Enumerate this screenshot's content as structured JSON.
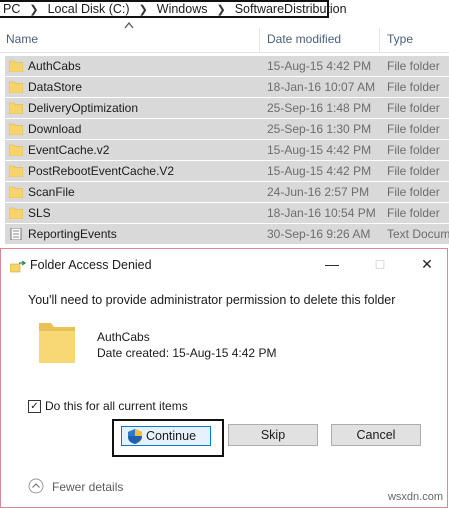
{
  "explorer": {
    "breadcrumb": [
      "PC",
      "Local Disk (C:)",
      "Windows",
      "SoftwareDistribution"
    ],
    "columns": {
      "name": "Name",
      "date": "Date modified",
      "type": "Type"
    },
    "rows": [
      {
        "name": "AuthCabs",
        "date": "15-Aug-15 4:42 PM",
        "type": "File folder",
        "icon": "folder-icon"
      },
      {
        "name": "DataStore",
        "date": "18-Jan-16 10:07 AM",
        "type": "File folder",
        "icon": "folder-icon"
      },
      {
        "name": "DeliveryOptimization",
        "date": "25-Sep-16 1:48 PM",
        "type": "File folder",
        "icon": "folder-icon"
      },
      {
        "name": "Download",
        "date": "25-Sep-16 1:30 PM",
        "type": "File folder",
        "icon": "folder-icon"
      },
      {
        "name": "EventCache.v2",
        "date": "15-Aug-15 4:42 PM",
        "type": "File folder",
        "icon": "folder-icon"
      },
      {
        "name": "PostRebootEventCache.V2",
        "date": "15-Aug-15 4:42 PM",
        "type": "File folder",
        "icon": "folder-icon"
      },
      {
        "name": "ScanFile",
        "date": "24-Jun-16 2:57 PM",
        "type": "File folder",
        "icon": "folder-icon"
      },
      {
        "name": "SLS",
        "date": "18-Jan-16 10:54 PM",
        "type": "File folder",
        "icon": "folder-icon"
      },
      {
        "name": "ReportingEvents",
        "date": "30-Sep-16 9:26 AM",
        "type": "Text Docum",
        "icon": "text-document-icon"
      }
    ]
  },
  "dialog": {
    "title": "Folder Access Denied",
    "message": "You'll need to provide administrator permission to delete this folder",
    "item_name": "AuthCabs",
    "item_date": "Date created: 15-Aug-15 4:42 PM",
    "checkbox_label": "Do this for all current items",
    "checkbox_checked": true,
    "continue_label": "Continue",
    "skip_label": "Skip",
    "cancel_label": "Cancel",
    "fewer_details_label": "Fewer details"
  },
  "watermark": "wsxdn.com",
  "colors": {
    "folder": "#f7d46b",
    "selected_row": "#d9d9d9",
    "accent": "#0078d7"
  }
}
